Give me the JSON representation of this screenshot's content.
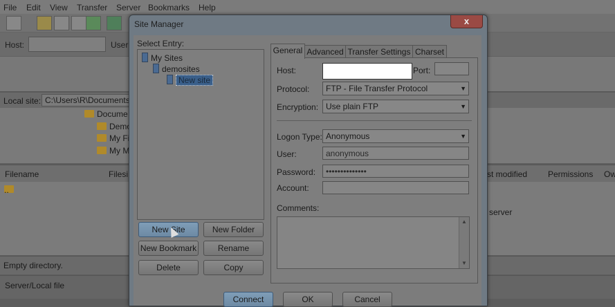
{
  "menu": [
    "File",
    "Edit",
    "View",
    "Transfer",
    "Server",
    "Bookmarks",
    "Help"
  ],
  "quickconnect": {
    "host_label": "Host:",
    "user_label": "User"
  },
  "local_site": {
    "label": "Local site:",
    "path": "C:\\Users\\R\\Documents\\W"
  },
  "local_tree": [
    "Docume",
    "Demo",
    "My Fi",
    "My M"
  ],
  "file_list": {
    "columns": [
      "Filename",
      "Filesi"
    ],
    "remote_columns": [
      "st modified",
      "Permissions",
      "Ow"
    ],
    "rows": [
      ".."
    ],
    "remote_hint": "server"
  },
  "status": {
    "local": "Empty directory.",
    "queue": "Server/Local file"
  },
  "dialog": {
    "title": "Site Manager",
    "close": "x",
    "select_entry_label": "Select Entry:",
    "tree": {
      "root": "My Sites",
      "folder": "demosites",
      "site": "New site"
    },
    "buttons": {
      "new_site": "New Site",
      "new_folder": "New Folder",
      "new_bookmark": "New Bookmark",
      "rename": "Rename",
      "delete": "Delete",
      "copy": "Copy",
      "connect": "Connect",
      "ok": "OK",
      "cancel": "Cancel"
    },
    "tabs": [
      "General",
      "Advanced",
      "Transfer Settings",
      "Charset"
    ],
    "general": {
      "host_label": "Host:",
      "host_value": "",
      "port_label": "Port:",
      "port_value": "",
      "protocol_label": "Protocol:",
      "protocol_value": "FTP - File Transfer Protocol",
      "encryption_label": "Encryption:",
      "encryption_value": "Use plain FTP",
      "logon_label": "Logon Type:",
      "logon_value": "Anonymous",
      "user_label": "User:",
      "user_value": "anonymous",
      "password_label": "Password:",
      "password_value": "••••••••••••••",
      "account_label": "Account:",
      "account_value": "",
      "comments_label": "Comments:"
    }
  }
}
